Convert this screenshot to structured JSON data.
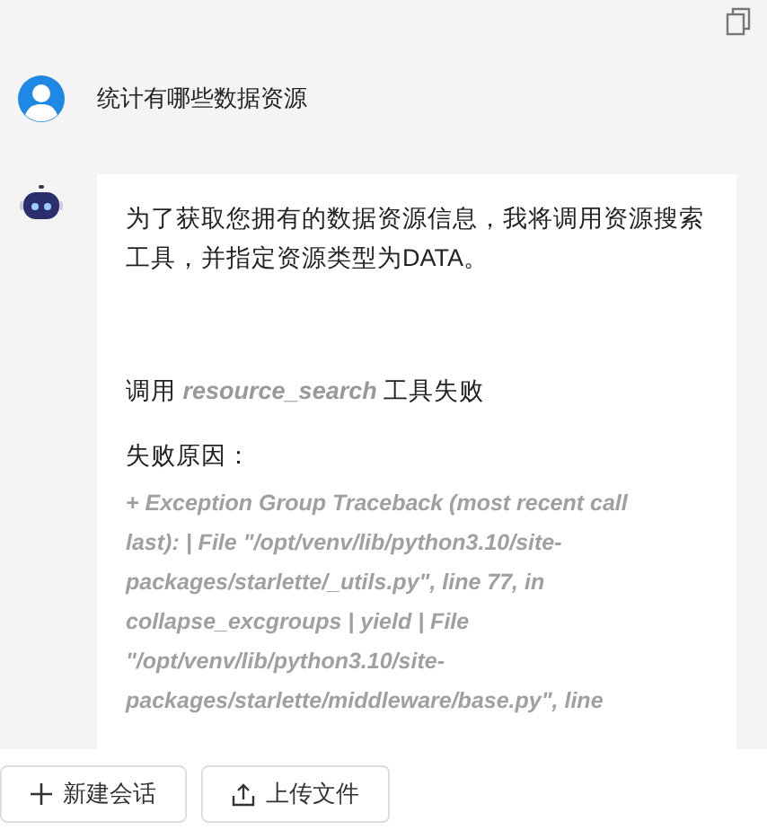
{
  "user_message": {
    "text": "统计有哪些数据资源"
  },
  "assistant_message": {
    "intro": "为了获取您拥有的数据资源信息，我将调用资源搜索工具，并指定资源类型为DATA。",
    "call_status": "调用 *resource_search* 工具失败",
    "reason_label": "失败原因：",
    "traceback_lines": [
      "+ Exception Group Traceback (most recent call",
      "last): | File \"/opt/venv/lib/python3.10/site-",
      "packages/starlette/_utils.py\", line 77, in",
      "collapse_excgroups | yield | File",
      "\"/opt/venv/lib/python3.10/site-",
      "packages/starlette/middleware/base.py\", line"
    ]
  },
  "buttons": [
    {
      "label": "新建会话",
      "kind": "new"
    },
    {
      "label": "上传文件",
      "kind": "upload"
    }
  ]
}
